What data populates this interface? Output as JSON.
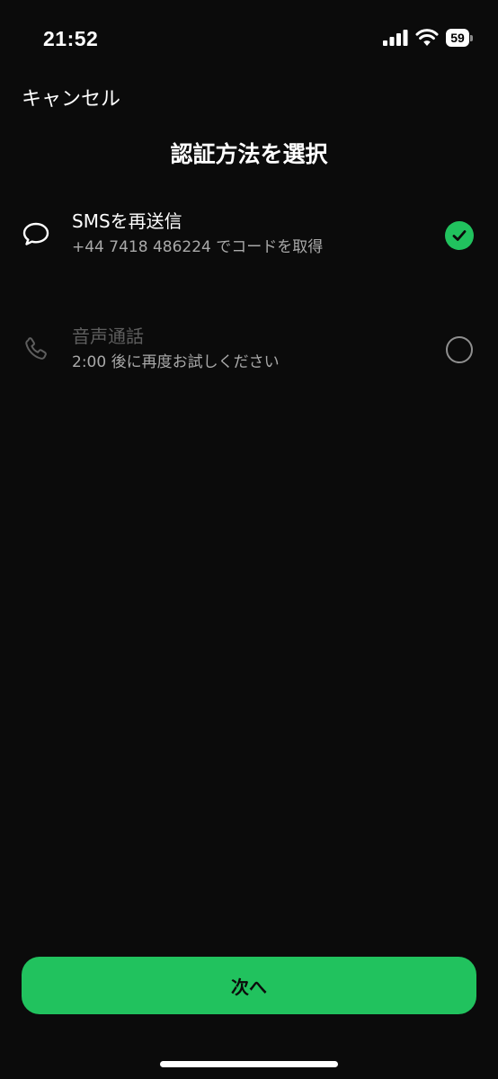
{
  "status_bar": {
    "time": "21:52",
    "battery_level": "59",
    "icons": [
      "cellular-signal-icon",
      "wifi-icon",
      "battery-icon"
    ]
  },
  "header": {
    "cancel_label": "キャンセル",
    "title": "認証方法を選択"
  },
  "options": [
    {
      "icon": "chat-bubble-icon",
      "title": "SMSを再送信",
      "subtitle": "+44 7418 486224 でコードを取得",
      "selected": true,
      "enabled": true
    },
    {
      "icon": "phone-icon",
      "title": "音声通話",
      "subtitle": "2:00 後に再度お試しください",
      "selected": false,
      "enabled": false
    }
  ],
  "footer": {
    "next_label": "次へ"
  },
  "colors": {
    "background": "#0b0b0b",
    "accent": "#21c25e",
    "text_primary": "#ffffff",
    "text_secondary": "#a9a9a9",
    "text_disabled": "#5e5e5e"
  }
}
